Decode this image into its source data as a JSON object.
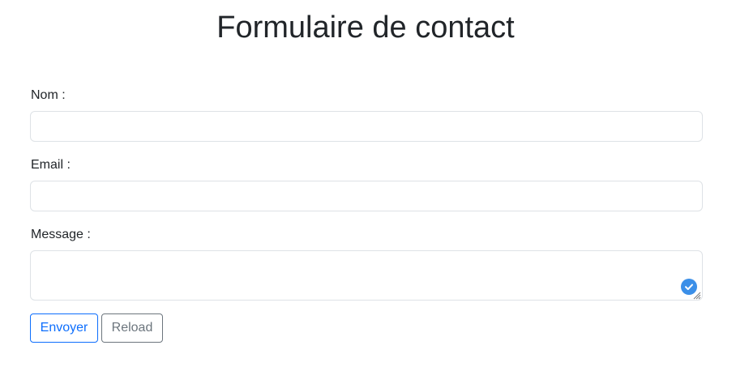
{
  "page": {
    "title": "Formulaire de contact"
  },
  "form": {
    "name_label": "Nom :",
    "name_value": "",
    "email_label": "Email :",
    "email_value": "",
    "message_label": "Message :",
    "message_value": "",
    "send_label": "Envoyer",
    "reload_label": "Reload"
  },
  "colors": {
    "primary": "#0d6efd",
    "secondary": "#6c757d",
    "input_border": "#dee2e6",
    "badge": "#3b8fe8"
  },
  "icons": {
    "textarea_badge": "check-circle-icon",
    "textarea_resize": "resize-grip-icon"
  }
}
